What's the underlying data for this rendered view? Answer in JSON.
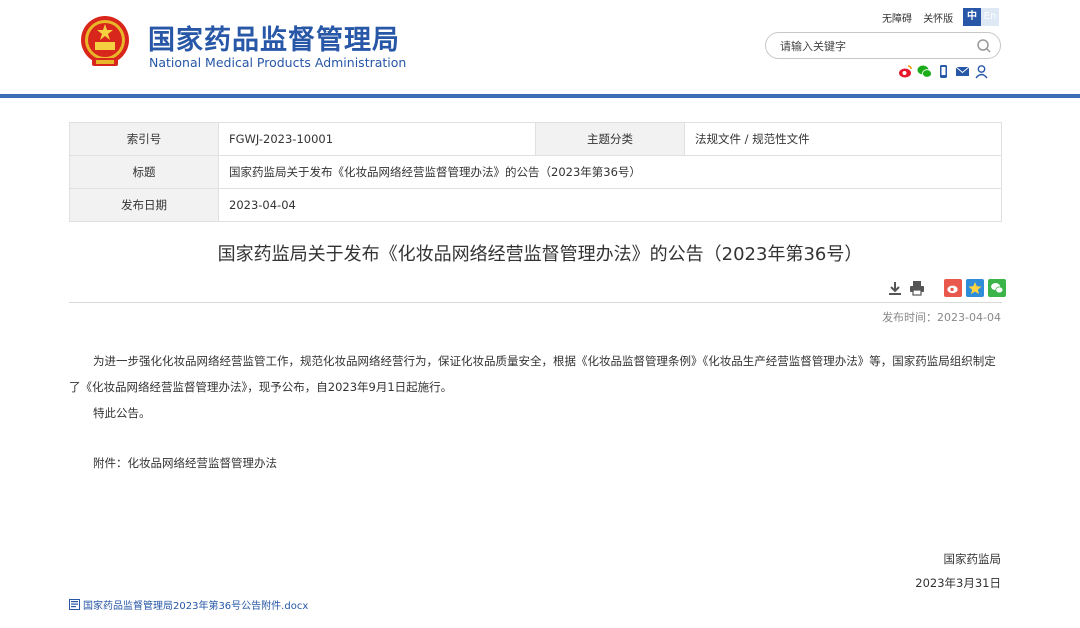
{
  "header": {
    "site_name_cn": "国家药品监督管理局",
    "site_name_en": "National Medical Products Administration",
    "top_links": [
      "无障碍",
      "关怀版"
    ],
    "lang_cn": "中",
    "lang_en": "En",
    "search_placeholder": "请输入关键字",
    "social_icons": [
      "weibo-icon",
      "wechat-icon",
      "mobile-icon",
      "mail-icon",
      "user-icon"
    ],
    "accent_color": "#2757a6"
  },
  "meta": {
    "index_label": "索引号",
    "index_value": "FGWJ-2023-10001",
    "category_label": "主题分类",
    "category_value": "法规文件 / 规范性文件",
    "title_label": "标题",
    "title_value": "国家药监局关于发布《化妆品网络经营监督管理办法》的公告（2023年第36号）",
    "date_label": "发布日期",
    "date_value": "2023-04-04"
  },
  "article": {
    "title": "国家药监局关于发布《化妆品网络经营监督管理办法》的公告（2023年第36号）",
    "publish_time": "发布时间：2023-04-04",
    "paragraphs": [
      "为进一步强化化妆品网络经营监管工作，规范化妆品网络经营行为，保证化妆品质量安全，根据《化妆品监督管理条例》《化妆品生产经营监督管理办法》等，国家药监局组织制定了《化妆品网络经营监督管理办法》，现予公布，自2023年9月1日起施行。",
      "特此公告。"
    ],
    "attachment_line": "附件：化妆品网络经营监督管理办法",
    "signer": "国家药监局",
    "sign_date": "2023年3月31日",
    "attachment_file": "国家药品监督管理局2023年第36号公告附件.docx"
  }
}
